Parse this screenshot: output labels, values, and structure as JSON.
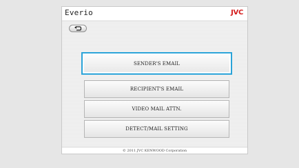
{
  "header": {
    "title": "Everio",
    "brand": "JVC",
    "back_icon": "back-arrow-icon"
  },
  "menu": {
    "items": [
      {
        "label": "SENDER'S EMAIL",
        "selected": true
      },
      {
        "label": "RECIPIENT'S EMAIL",
        "selected": false
      },
      {
        "label": "VIDEO MAIL ATTN.",
        "selected": false
      },
      {
        "label": "DETECT/MAIL SETTING",
        "selected": false
      }
    ]
  },
  "footer": {
    "copyright": "© 2011 JVC KENWOOD Corporation"
  },
  "colors": {
    "brand": "#d41b1b",
    "selection": "#2aa3d8"
  }
}
